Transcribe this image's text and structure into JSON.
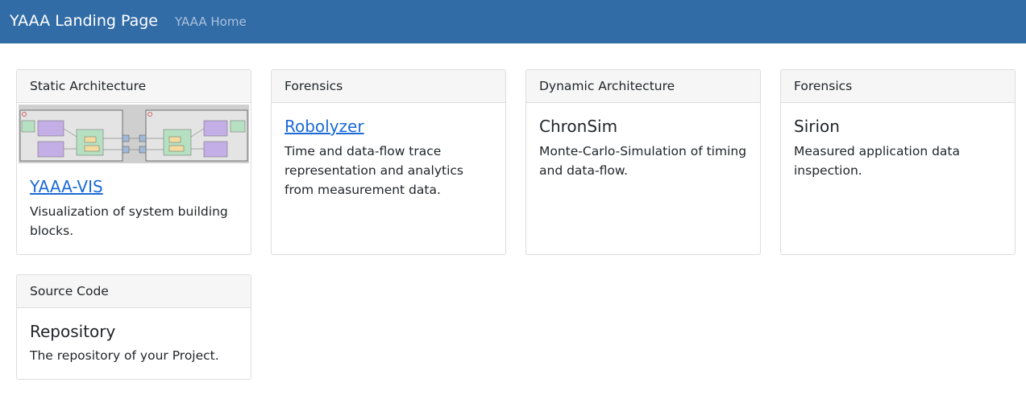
{
  "navbar": {
    "brand": "YAAA Landing Page",
    "home_link": "YAAA Home"
  },
  "cards": [
    {
      "header": "Static Architecture",
      "title": "YAAA-VIS",
      "text": "Visualization of system building blocks.",
      "has_image": true,
      "link": true
    },
    {
      "header": "Forensics",
      "title": "Robolyzer",
      "text": "Time and data-flow trace representation and analytics from measurement data.",
      "link": true
    },
    {
      "header": "Dynamic Architecture",
      "title": "ChronSim",
      "text": "Monte-Carlo-Simulation of timing and data-flow.",
      "link": false
    },
    {
      "header": "Forensics",
      "title": "Sirion",
      "text": "Measured application data inspection.",
      "link": false
    },
    {
      "header": "Source Code",
      "title": "Repository",
      "text": "The repository of your Project.",
      "link": false
    }
  ],
  "colors": {
    "navbar": "#326ca7",
    "link": "#1b6ad6",
    "card_header_bg": "#f6f6f6",
    "border": "#dddddd"
  }
}
